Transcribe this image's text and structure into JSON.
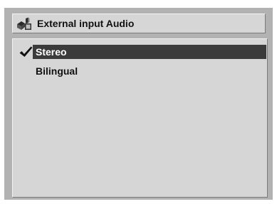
{
  "dialog": {
    "title": "External input Audio",
    "title_icon": "audio-source-icon"
  },
  "menu": {
    "items": [
      {
        "label": "Stereo",
        "checked": true,
        "highlighted": true
      },
      {
        "label": "Bilingual",
        "checked": false,
        "highlighted": false
      }
    ],
    "check_icon": "checkmark-icon"
  },
  "colors": {
    "frame": "#b2b2b2",
    "panel": "#d6d6d6",
    "highlight": "#3b3b3b",
    "text": "#111111",
    "highlight_text": "#ffffff"
  }
}
